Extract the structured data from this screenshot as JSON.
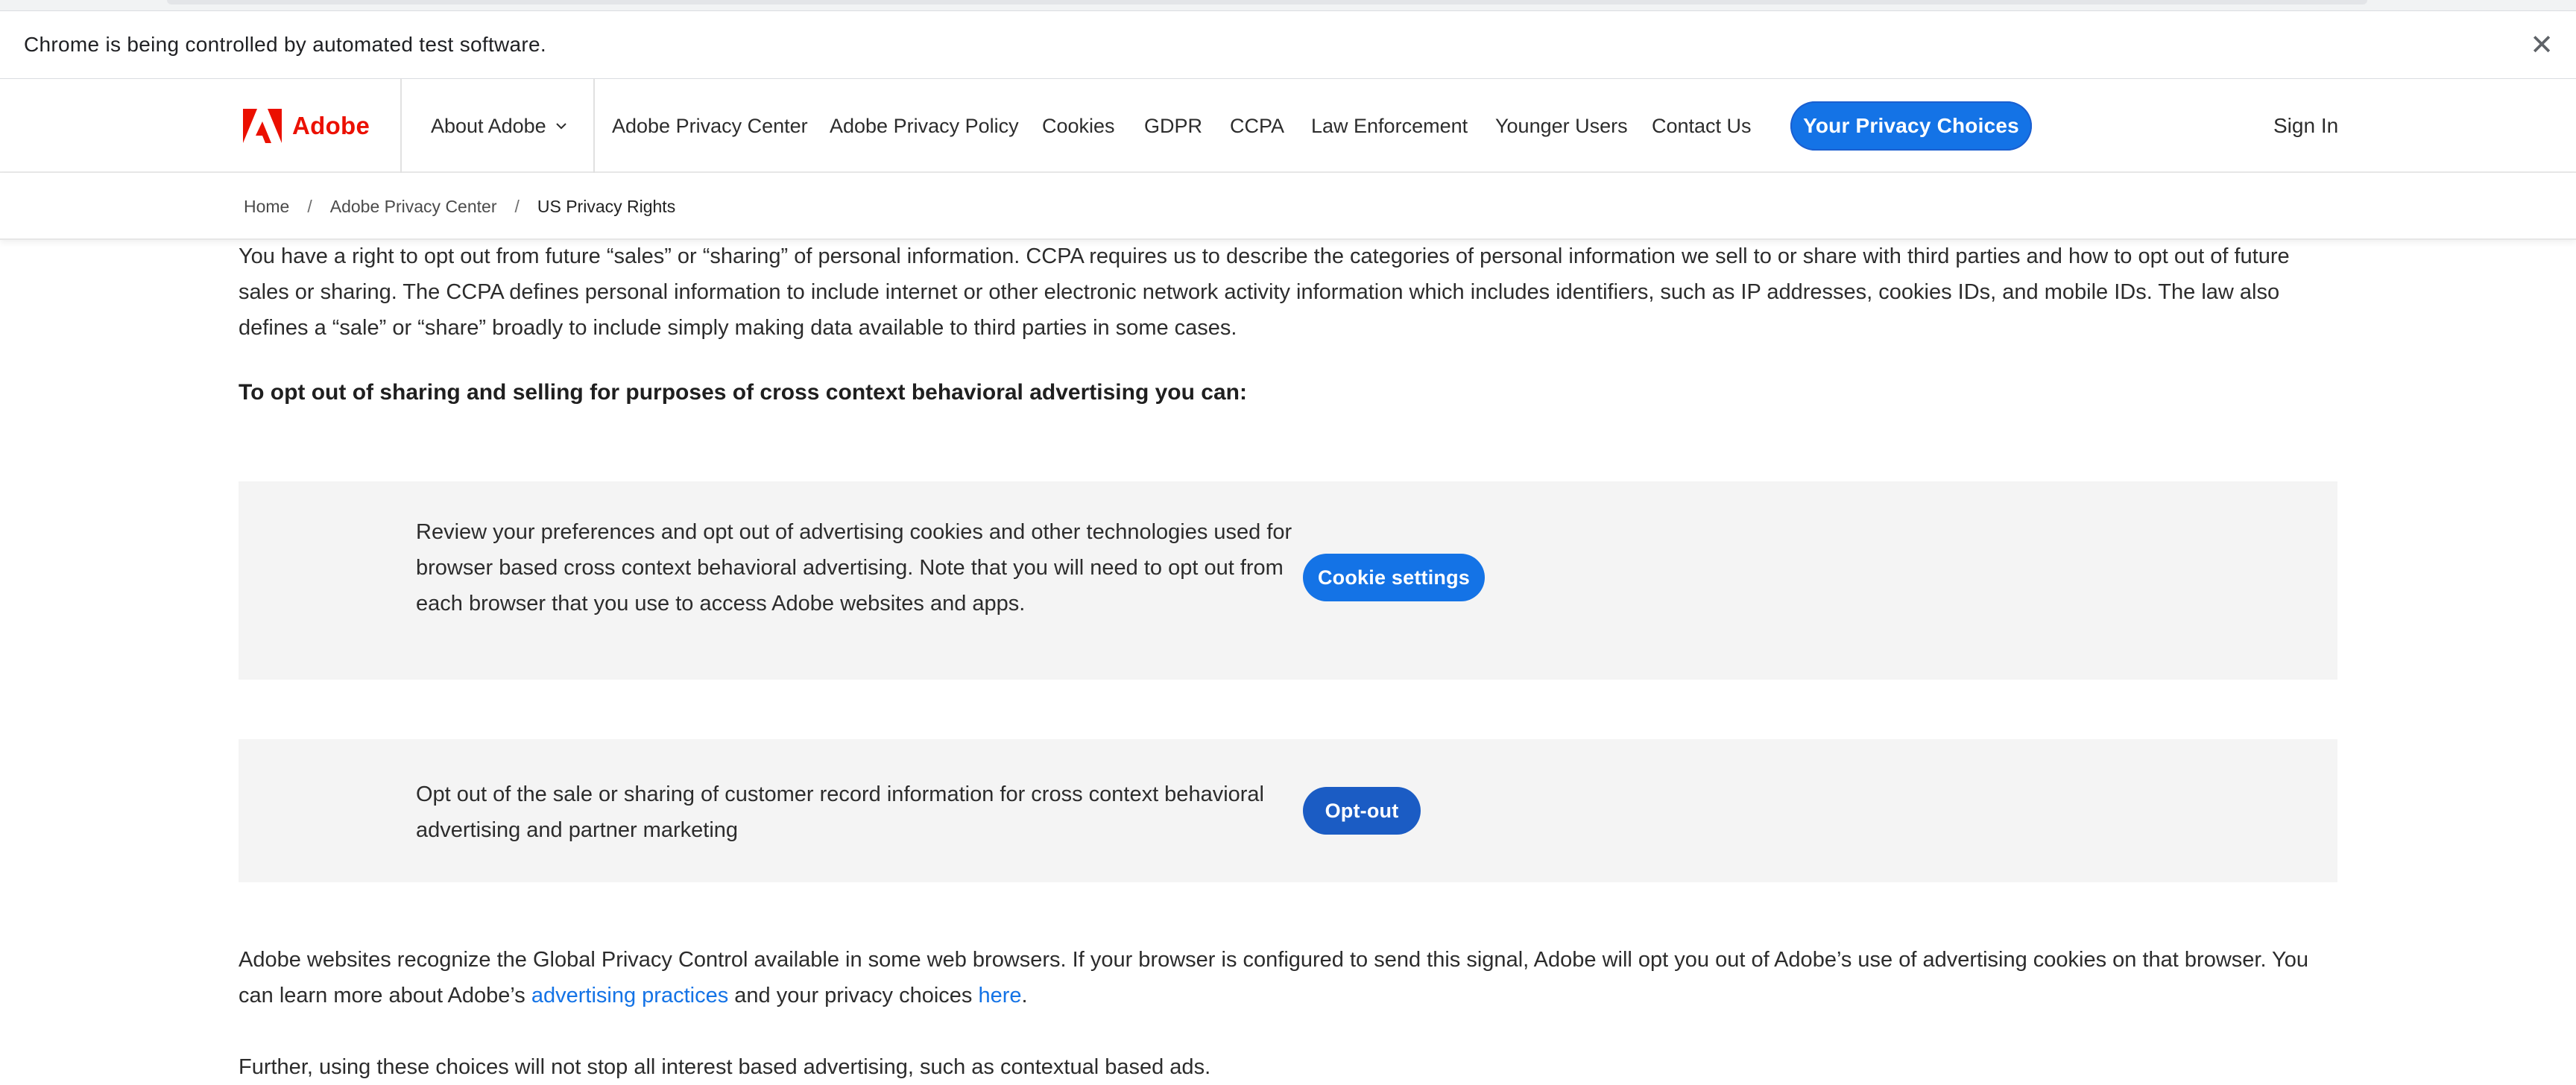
{
  "browser": {
    "automation_message": "Chrome is being controlled by automated test software.",
    "close_icon": "close-icon"
  },
  "nav": {
    "brand": "Adobe",
    "about": "About Adobe",
    "items": [
      "Adobe Privacy Center",
      "Adobe Privacy Policy",
      "Cookies",
      "GDPR",
      "CCPA",
      "Law Enforcement",
      "Younger Users",
      "Contact Us"
    ],
    "privacy_choices": "Your Privacy Choices",
    "sign_in": "Sign In",
    "colors": {
      "brand_red": "#eb1000",
      "accent_blue": "#1473e6"
    }
  },
  "breadcrumb": {
    "items": [
      "Home",
      "Adobe Privacy Center",
      "US Privacy Rights"
    ],
    "separator": "/"
  },
  "main": {
    "intro": "You have a right to opt out from future “sales” or “sharing” of personal information. CCPA requires us to describe the categories of personal information we sell to or share with third parties and how to opt out of future sales or sharing. The CCPA defines personal information to include internet or other electronic network activity information which includes identifiers, such as IP addresses, cookies IDs, and mobile IDs. The law also defines a “sale” or “share” broadly to include simply making data available to third parties in some cases.",
    "heading": "To opt out of sharing and selling for purposes of cross context behavioral advertising you can:",
    "panel_cookies": {
      "text": "Review your preferences and opt out of advertising cookies and other technologies used for browser based cross context behavioral advertising. Note that you will need to opt out from each browser that you use to access Adobe websites and apps.",
      "button": "Cookie settings"
    },
    "panel_optout": {
      "text": "Opt out of the sale or sharing of customer record information for cross context behavioral advertising and partner marketing",
      "button": "Opt-out"
    },
    "gpc": {
      "text_before": "Adobe websites recognize the Global Privacy Control available in some web browsers. If your browser is configured to send this signal, Adobe will opt you out of Adobe’s use of advertising cookies on that browser. You can learn more about Adobe’s ",
      "link_practices": "advertising practices",
      "text_middle": " and your privacy choices ",
      "link_here": "here",
      "text_after": "."
    },
    "further": "Further, using these choices will not stop all interest based advertising, such as contextual based ads."
  }
}
